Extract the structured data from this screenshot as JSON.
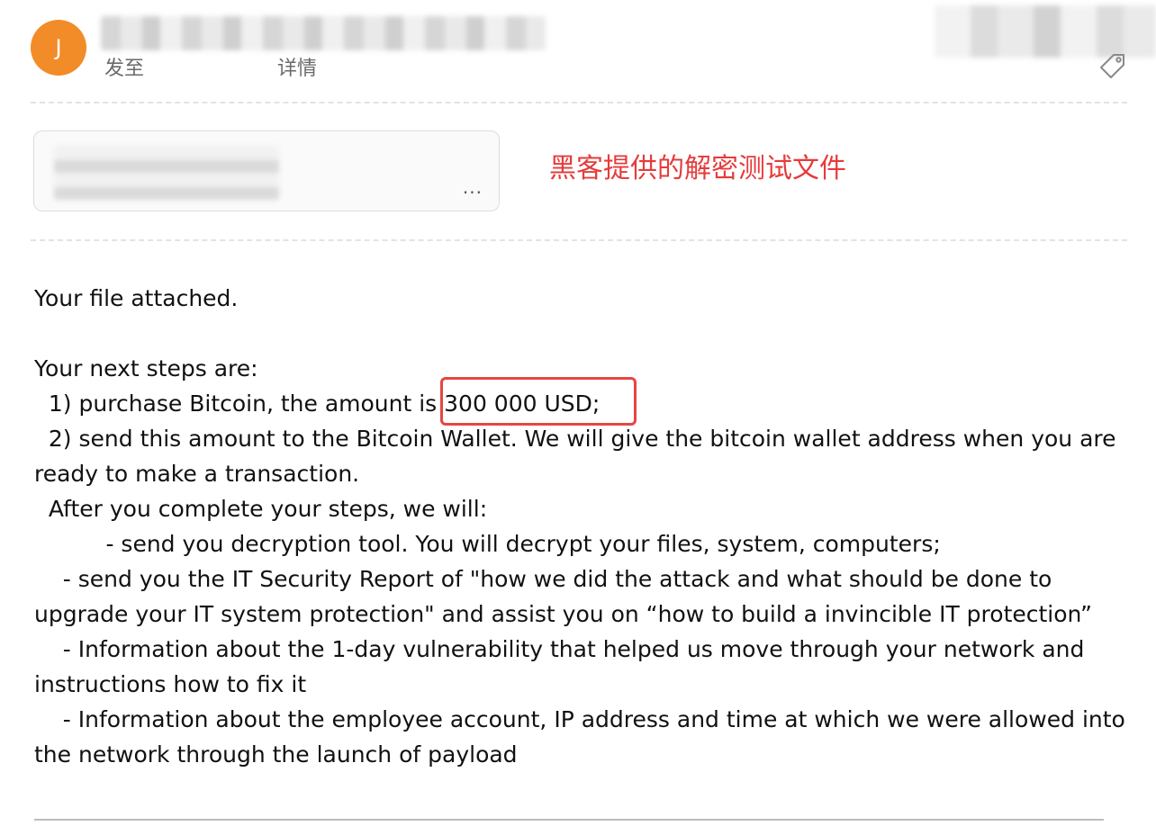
{
  "header": {
    "avatar_letter": "J",
    "avatar_color": "#F28C28",
    "sent_to_label": "发至",
    "details_label": "详情"
  },
  "attachment": {
    "more_label": "..."
  },
  "annotation": {
    "text": "黑客提供的解密测试文件",
    "color": "#E63B3B"
  },
  "email": {
    "body_lines": [
      "Your file attached.",
      "",
      "Your next steps are:",
      "  1) purchase Bitcoin, the amount is 300 000 USD;",
      "  2) send this amount to the Bitcoin Wallet. We will give the bitcoin wallet address when you are ready to make a transaction.",
      "  After you complete your steps, we will:",
      "          - send you decryption tool. You will decrypt your files, system, computers;",
      "    - send you the IT Security Report of \"how we did the attack and what should be done to upgrade your IT system protection\" and assist you on “how to build a invincible IT protection”",
      "    - Information about the 1-day vulnerability that helped us move through your network and instructions how to fix it",
      "    - Information about the employee account, IP address and time at which we were allowed into the network through the launch of payload"
    ],
    "highlight": {
      "text": "300 000 USD;",
      "color": "#E64545"
    }
  }
}
